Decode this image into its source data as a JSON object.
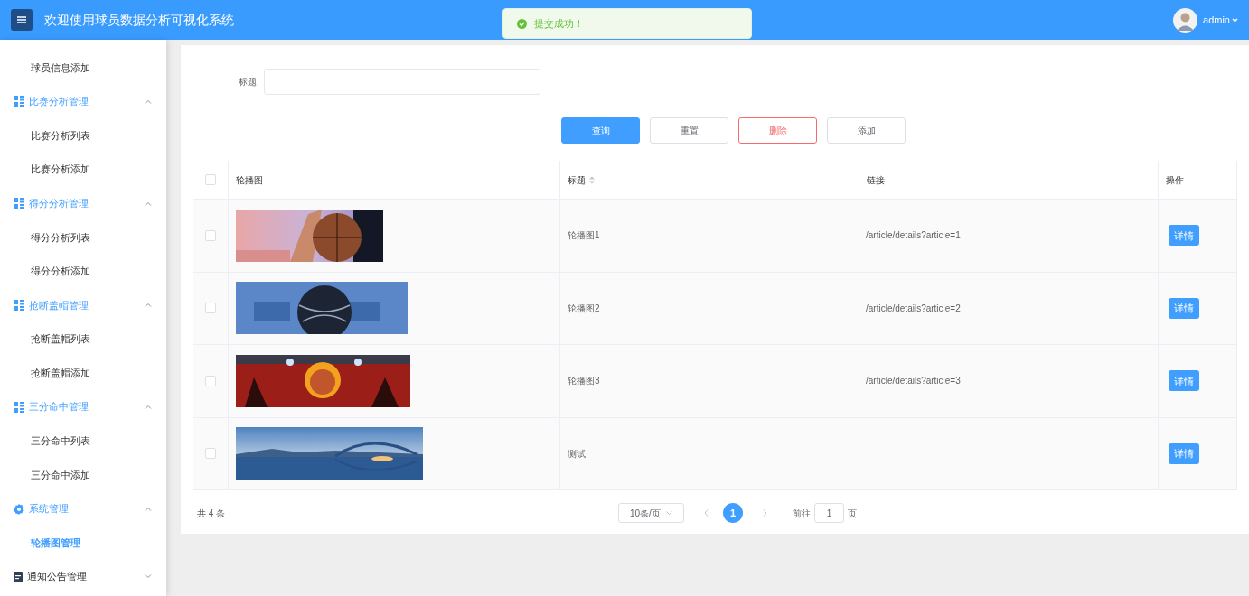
{
  "header": {
    "title": "欢迎使用球员数据分析可视化系统",
    "user": "admin"
  },
  "toast": {
    "message": "提交成功！"
  },
  "sidebar": {
    "items": [
      {
        "kind": "link",
        "label": "球员信息添加",
        "selected": false
      },
      {
        "kind": "grid",
        "label": "比赛分析管理",
        "expanded": true,
        "children": [
          {
            "label": "比赛分析列表",
            "selected": false
          },
          {
            "label": "比赛分析添加",
            "selected": false
          }
        ]
      },
      {
        "kind": "grid",
        "label": "得分分析管理",
        "expanded": true,
        "children": [
          {
            "label": "得分分析列表",
            "selected": false
          },
          {
            "label": "得分分析添加",
            "selected": false
          }
        ]
      },
      {
        "kind": "grid",
        "label": "抢断盖帽管理",
        "expanded": true,
        "children": [
          {
            "label": "抢断盖帽列表",
            "selected": false
          },
          {
            "label": "抢断盖帽添加",
            "selected": false
          }
        ]
      },
      {
        "kind": "grid",
        "label": "三分命中管理",
        "expanded": true,
        "children": [
          {
            "label": "三分命中列表",
            "selected": false
          },
          {
            "label": "三分命中添加",
            "selected": false
          }
        ]
      },
      {
        "kind": "gear",
        "label": "系统管理",
        "expanded": true,
        "children": [
          {
            "label": "轮播图管理",
            "selected": true
          }
        ]
      },
      {
        "kind": "doc",
        "label": "通知公告管理",
        "expanded": false
      }
    ]
  },
  "search": {
    "label": "标题"
  },
  "buttons": [
    {
      "kind": "primary",
      "label": "查询"
    },
    {
      "kind": "default",
      "label": "重置"
    },
    {
      "kind": "danger",
      "label": "删除"
    },
    {
      "kind": "default",
      "label": "添加"
    }
  ],
  "table": {
    "select_all_checked": false,
    "columns": [
      {
        "label": "轮播图",
        "sortable": false
      },
      {
        "label": "标题",
        "sortable": true
      },
      {
        "label": "链接",
        "sortable": false
      },
      {
        "label": "操作",
        "sortable": false
      }
    ],
    "rows": [
      {
        "checked": false,
        "title": "轮播图1",
        "link": "/article/details?article=1",
        "action": "详情"
      },
      {
        "checked": false,
        "title": "轮播图2",
        "link": "/article/details?article=2",
        "action": "详情"
      },
      {
        "checked": false,
        "title": "轮播图3",
        "link": "/article/details?article=3",
        "action": "详情"
      },
      {
        "checked": false,
        "title": "测试",
        "action": "详情"
      }
    ]
  },
  "pagination": {
    "total": "共 4 条",
    "page_size": "10条/页",
    "pages": [
      {
        "label": "1",
        "selected": true
      }
    ],
    "goto_label": "前往",
    "goto_value": "1",
    "goto_suffix": "页"
  }
}
